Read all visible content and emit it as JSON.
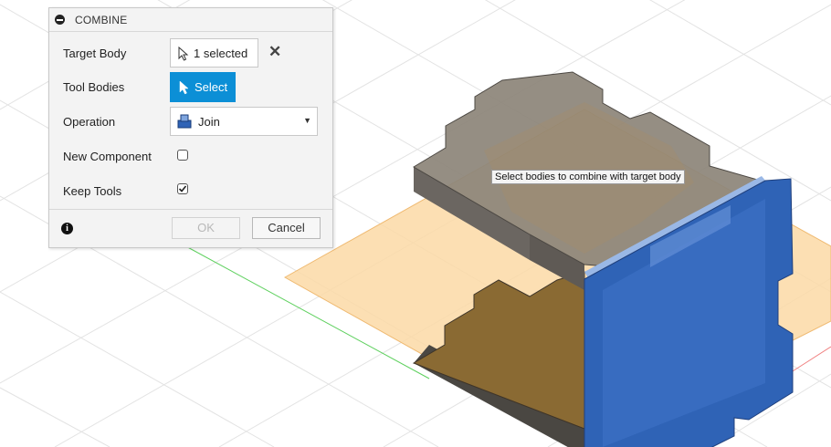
{
  "dialog": {
    "title": "COMBINE",
    "rows": {
      "target_body": {
        "label": "Target Body",
        "value": "1 selected"
      },
      "tool_bodies": {
        "label": "Tool Bodies",
        "button": "Select"
      },
      "operation": {
        "label": "Operation",
        "selected": "Join"
      },
      "new_component": {
        "label": "New Component",
        "checked": false
      },
      "keep_tools": {
        "label": "Keep Tools",
        "checked": true
      }
    },
    "ok_label": "OK",
    "cancel_label": "Cancel"
  },
  "tooltip": "Select bodies to combine with target body",
  "colors": {
    "accent": "#0c8fd6",
    "body_blue": "#2d63b8",
    "body_gray": "#8c847a",
    "plane_orange": "#fbd9a6"
  }
}
